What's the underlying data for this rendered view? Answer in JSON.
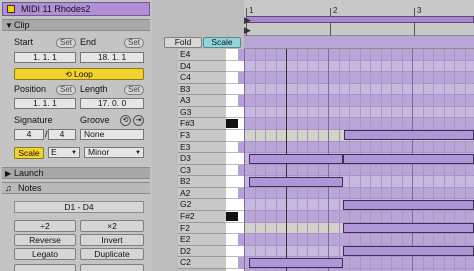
{
  "clip": {
    "title": "MIDI 11  Rhodes2",
    "section": "Clip",
    "start_label": "Start",
    "end_label": "End",
    "set": "Set",
    "start_value": "1.   1.   1",
    "end_value": "18.   1.   1",
    "loop_label": "Loop",
    "position_label": "Position",
    "length_label": "Length",
    "position_value": "1.   1.   1",
    "length_value": "17.   0.   0",
    "signature_label": "Signature",
    "groove_label": "Groove",
    "sig_num": "4",
    "sig_den": "4",
    "groove_value": "None",
    "slash": "/",
    "scale_btn": "Scale",
    "key": "E",
    "mode": "Minor"
  },
  "launch": {
    "label": "Launch"
  },
  "notes": {
    "label": "Notes",
    "range": "D1 - D4",
    "div2": "÷2",
    "mul2": "×2",
    "reverse": "Reverse",
    "invert": "Invert",
    "legato": "Legato",
    "duplicate": "Duplicate"
  },
  "editor": {
    "fold": "Fold",
    "scale": "Scale",
    "ruler": [
      "1",
      "2",
      "3"
    ],
    "rows": [
      "E4",
      "D4",
      "C4",
      "B3",
      "A3",
      "G3",
      "F#3",
      "F3",
      "E3",
      "D3",
      "C3",
      "B2",
      "A2",
      "G2",
      "F#2",
      "F2",
      "E2",
      "D2",
      "C2"
    ]
  },
  "colors": {
    "accent": "#b095d8",
    "clip_title": "#b18fd8",
    "active_yellow": "#f2d22c"
  }
}
